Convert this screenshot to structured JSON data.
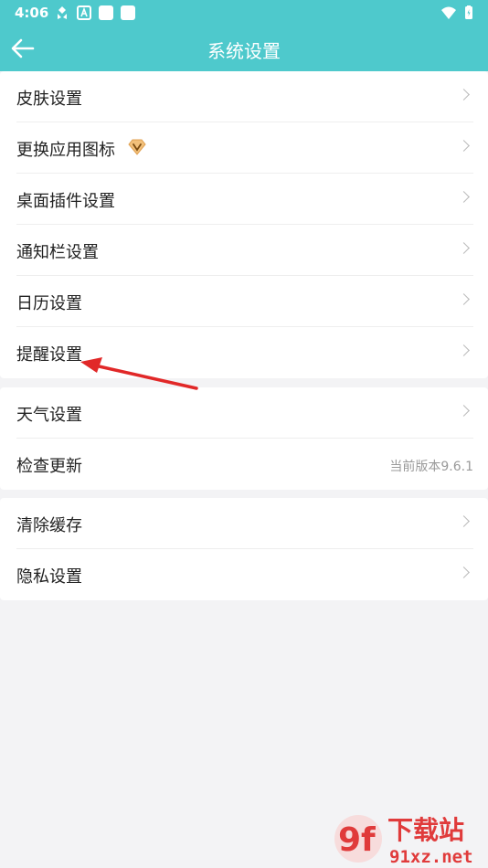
{
  "status_bar": {
    "time": "4:06",
    "icons": [
      "sync-icon",
      "app-a-icon",
      "app-square-icon",
      "app-square-icon",
      "wifi-icon",
      "battery-icon"
    ]
  },
  "header": {
    "title": "系统设置",
    "back_icon": "arrow-left-icon"
  },
  "groups": [
    {
      "items": [
        {
          "label": "皮肤设置"
        },
        {
          "label": "更换应用图标",
          "badge_icon": "vip-diamond-icon"
        },
        {
          "label": "桌面插件设置"
        },
        {
          "label": "通知栏设置"
        },
        {
          "label": "日历设置"
        },
        {
          "label": "提醒设置"
        }
      ]
    },
    {
      "items": [
        {
          "label": "天气设置"
        },
        {
          "label": "检查更新",
          "value": "当前版本9.6.1"
        }
      ]
    },
    {
      "items": [
        {
          "label": "清除缓存"
        },
        {
          "label": "隐私设置"
        }
      ]
    }
  ],
  "watermark": {
    "logo_text": "9f",
    "brand": "下载站",
    "site": "91xz.net"
  },
  "colors": {
    "accent": "#4ec9cc",
    "annotation_arrow": "#e12828",
    "background": "#f3f3f5"
  }
}
